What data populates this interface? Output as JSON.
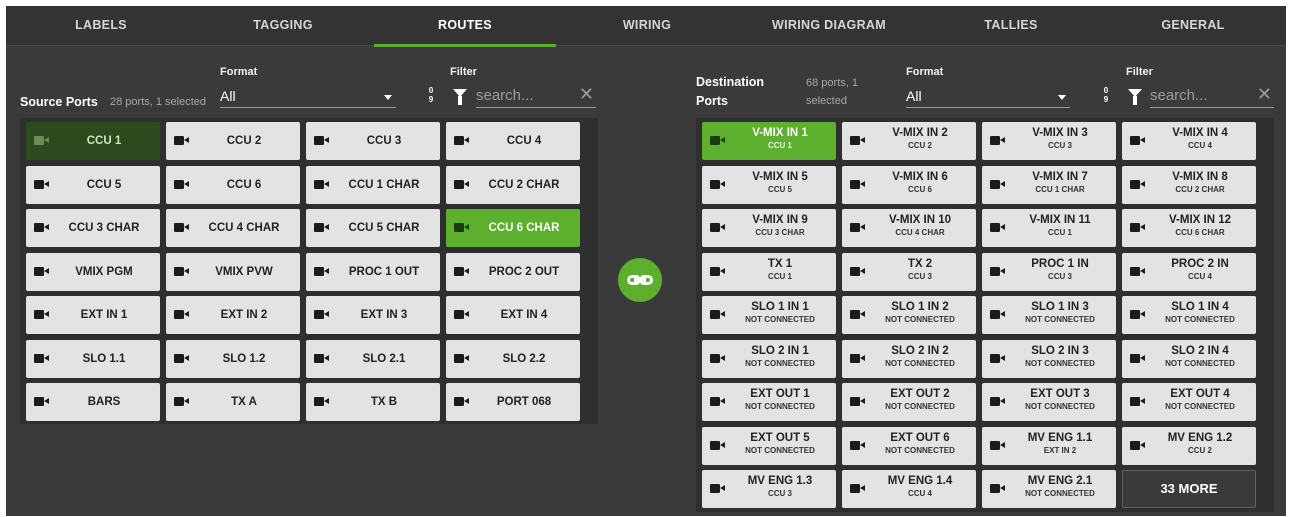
{
  "tabs": [
    "LABELS",
    "TAGGING",
    "ROUTES",
    "WIRING",
    "WIRING DIAGRAM",
    "TALLIES",
    "GENERAL"
  ],
  "active_tab": "ROUTES",
  "source": {
    "title": "Source Ports",
    "count": "28 ports, 1 selected",
    "format_label": "Format",
    "format_value": "All",
    "filter_label": "Filter",
    "sort_icon": "09",
    "search_placeholder": "search...",
    "ports": [
      "CCU 1",
      "CCU 2",
      "CCU 3",
      "CCU 4",
      "CCU 5",
      "CCU 6",
      "CCU 1 CHAR",
      "CCU 2 CHAR",
      "CCU 3 CHAR",
      "CCU 4 CHAR",
      "CCU 5 CHAR",
      "CCU 6 CHAR",
      "VMIX PGM",
      "VMIX PVW",
      "PROC 1 OUT",
      "PROC 2 OUT",
      "EXT IN 1",
      "EXT IN 2",
      "EXT IN 3",
      "EXT IN 4",
      "SLO 1.1",
      "SLO 1.2",
      "SLO 2.1",
      "SLO 2.2",
      "BARS",
      "TX A",
      "TX B",
      "PORT 068"
    ],
    "selected": "CCU 6 CHAR",
    "highlighted": "CCU 1"
  },
  "destination": {
    "title_line1": "Destination",
    "title_line2": "Ports",
    "count_line1": "68 ports, 1",
    "count_line2": "selected",
    "format_label": "Format",
    "format_value": "All",
    "filter_label": "Filter",
    "sort_icon": "09",
    "search_placeholder": "search...",
    "ports": [
      {
        "name": "V-MIX IN 1",
        "src": "CCU 1"
      },
      {
        "name": "V-MIX IN 2",
        "src": "CCU 2"
      },
      {
        "name": "V-MIX IN 3",
        "src": "CCU 3"
      },
      {
        "name": "V-MIX IN 4",
        "src": "CCU 4"
      },
      {
        "name": "V-MIX IN 5",
        "src": "CCU 5"
      },
      {
        "name": "V-MIX IN 6",
        "src": "CCU 6"
      },
      {
        "name": "V-MIX IN 7",
        "src": "CCU 1 CHAR"
      },
      {
        "name": "V-MIX IN 8",
        "src": "CCU 2 CHAR"
      },
      {
        "name": "V-MIX IN 9",
        "src": "CCU 3 CHAR"
      },
      {
        "name": "V-MIX IN 10",
        "src": "CCU 4 CHAR"
      },
      {
        "name": "V-MIX IN 11",
        "src": "CCU 1"
      },
      {
        "name": "V-MIX IN 12",
        "src": "CCU 6 CHAR"
      },
      {
        "name": "TX 1",
        "src": "CCU 1"
      },
      {
        "name": "TX 2",
        "src": "CCU 3"
      },
      {
        "name": "PROC 1 IN",
        "src": "CCU 3"
      },
      {
        "name": "PROC 2 IN",
        "src": "CCU 4"
      },
      {
        "name": "SLO 1 IN 1",
        "src": "NOT CONNECTED"
      },
      {
        "name": "SLO 1 IN 2",
        "src": "NOT CONNECTED"
      },
      {
        "name": "SLO 1 IN 3",
        "src": "NOT CONNECTED"
      },
      {
        "name": "SLO 1 IN 4",
        "src": "NOT CONNECTED"
      },
      {
        "name": "SLO 2 IN 1",
        "src": "NOT CONNECTED"
      },
      {
        "name": "SLO 2 IN 2",
        "src": "NOT CONNECTED"
      },
      {
        "name": "SLO 2 IN 3",
        "src": "NOT CONNECTED"
      },
      {
        "name": "SLO 2 IN 4",
        "src": "NOT CONNECTED"
      },
      {
        "name": "EXT OUT 1",
        "src": "NOT CONNECTED"
      },
      {
        "name": "EXT OUT 2",
        "src": "NOT CONNECTED"
      },
      {
        "name": "EXT OUT 3",
        "src": "NOT CONNECTED"
      },
      {
        "name": "EXT OUT 4",
        "src": "NOT CONNECTED"
      },
      {
        "name": "EXT OUT 5",
        "src": "NOT CONNECTED"
      },
      {
        "name": "EXT OUT 6",
        "src": "NOT CONNECTED"
      },
      {
        "name": "MV ENG 1.1",
        "src": "EXT IN 2"
      },
      {
        "name": "MV ENG 1.2",
        "src": "CCU 2"
      },
      {
        "name": "MV ENG 1.3",
        "src": "CCU 3"
      },
      {
        "name": "MV ENG 1.4",
        "src": "CCU 4"
      },
      {
        "name": "MV ENG 2.1",
        "src": "NOT CONNECTED"
      }
    ],
    "selected": "V-MIX IN 1",
    "more_label": "33 MORE"
  },
  "colors": {
    "accent": "#5cb02e",
    "background": "#3a3a3a",
    "tile": "#e3e3e3"
  },
  "icons": {
    "link": "link-icon",
    "camera": "camera-icon",
    "filter": "filter-icon",
    "sort": "sort-numeric-icon",
    "clear": "close-icon"
  }
}
